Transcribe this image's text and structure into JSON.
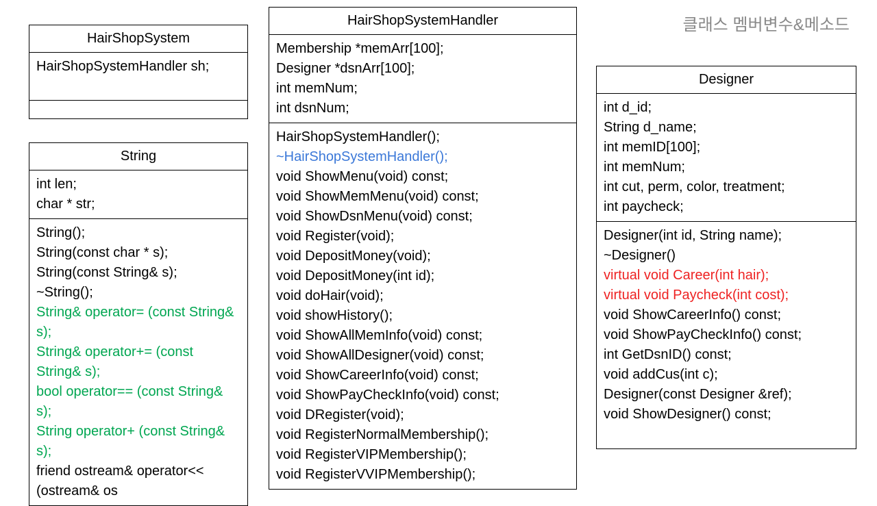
{
  "pageTitle": "클래스 멤버변수&메소드",
  "boxes": {
    "hairShopSystem": {
      "title": "HairShopSystem",
      "attributes": [
        {
          "text": "HairShopSystemHandler sh;",
          "color": "black"
        }
      ],
      "methods": []
    },
    "string": {
      "title": "String",
      "attributes": [
        {
          "text": "int len;",
          "color": "black"
        },
        {
          "text": "char * str;",
          "color": "black"
        }
      ],
      "methods": [
        {
          "text": "String();",
          "color": "black"
        },
        {
          "text": "String(const char * s);",
          "color": "black"
        },
        {
          "text": "String(const String& s);",
          "color": "black"
        },
        {
          "text": "~String();",
          "color": "black"
        },
        {
          "text": "String& operator= (const String& s);",
          "color": "green"
        },
        {
          "text": "String& operator+= (const String& s);",
          "color": "green"
        },
        {
          "text": "bool operator== (const String& s);",
          "color": "green"
        },
        {
          "text": "String operator+ (const String& s);",
          "color": "green"
        },
        {
          "text": "friend ostream& operator<< (ostream& os",
          "color": "black"
        }
      ]
    },
    "handler": {
      "title": "HairShopSystemHandler",
      "attributes": [
        {
          "text": "Membership *memArr[100];",
          "color": "black"
        },
        {
          "text": "Designer *dsnArr[100];",
          "color": "black"
        },
        {
          "text": "int memNum;",
          "color": "black"
        },
        {
          "text": "int dsnNum;",
          "color": "black"
        }
      ],
      "methods": [
        {
          "text": "HairShopSystemHandler();",
          "color": "black"
        },
        {
          "text": "~HairShopSystemHandler();",
          "color": "blue"
        },
        {
          "text": "void ShowMenu(void) const;",
          "color": "black"
        },
        {
          "text": "void ShowMemMenu(void) const;",
          "color": "black"
        },
        {
          "text": "void ShowDsnMenu(void) const;",
          "color": "black"
        },
        {
          "text": "void Register(void);",
          "color": "black"
        },
        {
          "text": "void DepositMoney(void);",
          "color": "black"
        },
        {
          "text": "void DepositMoney(int id);",
          "color": "black"
        },
        {
          "text": "void doHair(void);",
          "color": "black"
        },
        {
          "text": "void showHistory();",
          "color": "black"
        },
        {
          "text": "void ShowAllMemInfo(void) const;",
          "color": "black"
        },
        {
          "text": "void ShowAllDesigner(void) const;",
          "color": "black"
        },
        {
          "text": "void ShowCareerInfo(void) const;",
          "color": "black"
        },
        {
          "text": "void ShowPayCheckInfo(void) const;",
          "color": "black"
        },
        {
          "text": "void DRegister(void);",
          "color": "black"
        },
        {
          "text": "void RegisterNormalMembership();",
          "color": "black"
        },
        {
          "text": "void RegisterVIPMembership();",
          "color": "black"
        },
        {
          "text": "void RegisterVVIPMembership();",
          "color": "black"
        }
      ]
    },
    "designer": {
      "title": "Designer",
      "attributes": [
        {
          "text": "int d_id;",
          "color": "black"
        },
        {
          "text": "String d_name;",
          "color": "black"
        },
        {
          "text": "int memID[100];",
          "color": "black"
        },
        {
          "text": "int memNum;",
          "color": "black"
        },
        {
          "text": "int cut, perm, color, treatment;",
          "color": "black"
        },
        {
          "text": "int paycheck;",
          "color": "black"
        }
      ],
      "methods": [
        {
          "text": "Designer(int id, String name);",
          "color": "black"
        },
        {
          "text": "~Designer()",
          "color": "black"
        },
        {
          "text": "virtual void Career(int hair);",
          "color": "red"
        },
        {
          "text": "virtual void Paycheck(int cost);",
          "color": "red"
        },
        {
          "text": "void ShowCareerInfo() const;",
          "color": "black"
        },
        {
          "text": "void ShowPayCheckInfo() const;",
          "color": "black"
        },
        {
          "text": "int GetDsnID() const;",
          "color": "black"
        },
        {
          "text": "void addCus(int c);",
          "color": "black"
        },
        {
          "text": "Designer(const Designer &ref);",
          "color": "black"
        },
        {
          "text": "void ShowDesigner() const;",
          "color": "black"
        },
        {
          "text": " ",
          "color": "black"
        }
      ]
    }
  }
}
